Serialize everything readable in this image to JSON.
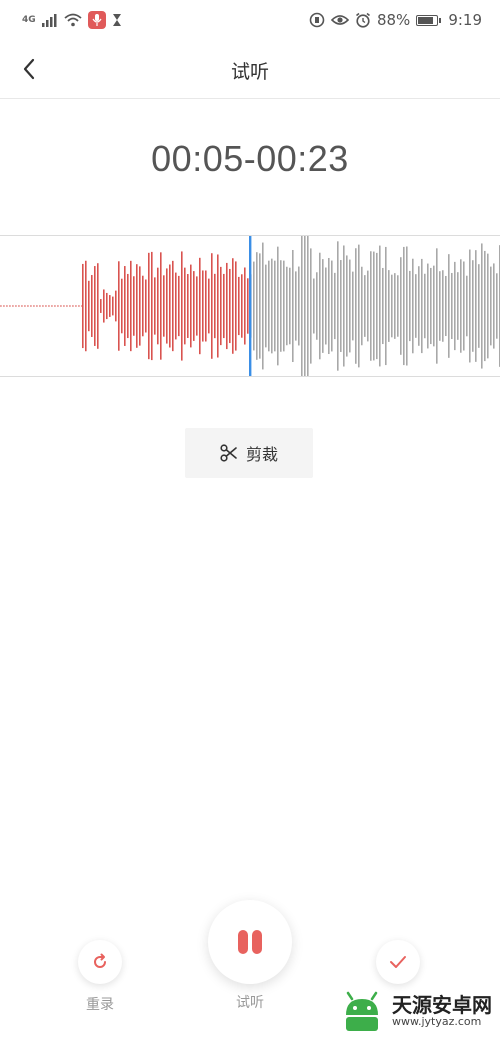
{
  "status_bar": {
    "network": "4G",
    "battery": "88%",
    "battery_level": 0.88,
    "time": "9:19"
  },
  "header": {
    "title": "试听"
  },
  "time_range": "00:05-00:23",
  "trim_button": {
    "label": "剪裁"
  },
  "controls": {
    "rerecord_label": "重录",
    "preview_label": "试听",
    "confirm_label": ""
  },
  "watermark": {
    "name": "天源安卓网",
    "url": "www.jytyaz.com"
  },
  "colors": {
    "played_wave": "#d9534f",
    "unplayed_wave": "#a8a8a8",
    "playhead": "#3a8ee6",
    "accent": "#e8625e"
  }
}
